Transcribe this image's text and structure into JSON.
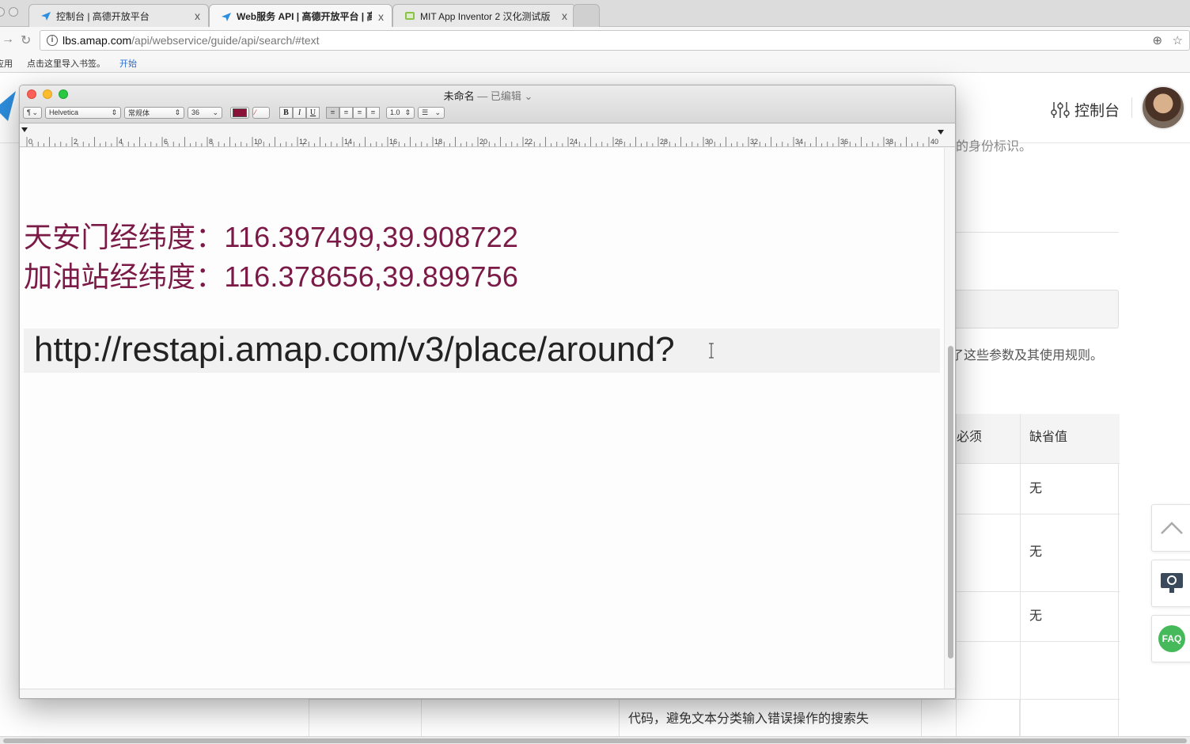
{
  "browser": {
    "tabs": [
      {
        "title": "控制台 | 高德开放平台",
        "close": "x"
      },
      {
        "title": "Web服务 API | 高德开放平台 | 高",
        "close": "x"
      },
      {
        "title": "MIT App Inventor 2 汉化测试版",
        "close": "x"
      }
    ],
    "address": {
      "host": "lbs.amap.com",
      "path": "/api/webservice/guide/api/search/#text"
    },
    "bookmarks": {
      "apps": "应用",
      "import_hint": "点击这里导入书签。",
      "start": "开始"
    }
  },
  "webpage": {
    "console_label": "控制台",
    "partial_top_text": "的身份标识。",
    "param_note": "了这些参数及其使用规则。",
    "table": {
      "headers": [
        "必须",
        "缺省值"
      ],
      "rows": [
        {
          "default": "无"
        },
        {
          "default": "无"
        },
        {
          "default": "无"
        }
      ]
    },
    "bottom_text": "代码，避免文本分类输入错误操作的搜索失",
    "faq_label": "FAQ"
  },
  "textedit": {
    "title": "未命名",
    "title_sep": " — ",
    "edited": "已编辑",
    "format_bar": {
      "paragraph": "¶",
      "font": "Helvetica",
      "style": "常规体",
      "size": "36",
      "bold": "B",
      "italic": "I",
      "underline": "U",
      "spacing": "1.0",
      "list": "☰"
    },
    "ruler_labels": [
      "0",
      "2",
      "4",
      "6",
      "8",
      "10",
      "12",
      "14",
      "16",
      "18",
      "20",
      "22",
      "24",
      "26",
      "28",
      "30",
      "32",
      "34",
      "36",
      "38",
      "40"
    ],
    "content": {
      "line1_label": "天安门经纬度：",
      "line1_value": "116.397499,39.908722",
      "line2_label": "加油站经纬度：",
      "line2_value": "116.378656,39.899756",
      "url": "http://restapi.amap.com/v3/place/around?"
    },
    "colors": {
      "text": "#7b1a47"
    }
  }
}
